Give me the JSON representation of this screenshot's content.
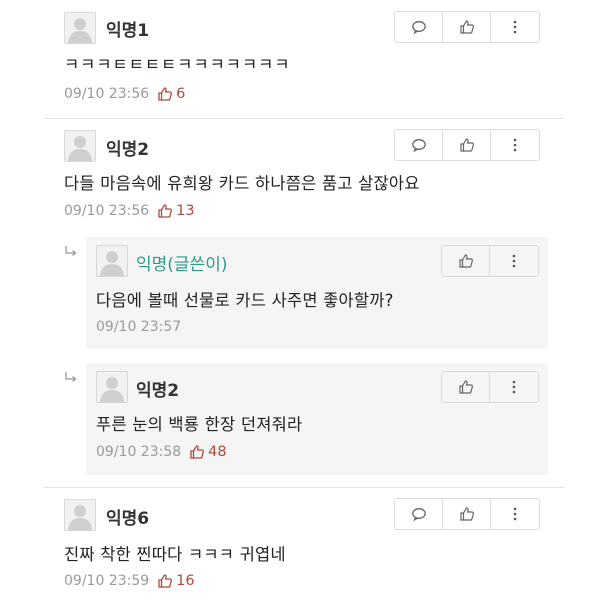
{
  "comments": [
    {
      "nickname": "익명1",
      "text": "ㅋㅋㅋㅌㅌㅌㅌㅋㅋㅋㅋㅋㅋㅋ",
      "time": "09/10 23:56",
      "likes": "6"
    },
    {
      "nickname": "익명2",
      "text": "다들 마음속에 유희왕 카드 하나쯤은 품고 살잖아요",
      "time": "09/10 23:56",
      "likes": "13"
    },
    {
      "nickname": "익명6",
      "text": "진짜 착한 찐따다 ㅋㅋㅋ 귀엽네",
      "time": "09/10 23:59",
      "likes": "16"
    }
  ],
  "replies": [
    {
      "nickname": "익명(글쓴이)",
      "text": "다음에 볼때 선물로 카드 사주면 좋아할까?",
      "time": "09/10 23:57",
      "likes": ""
    },
    {
      "nickname": "익명2",
      "text": "푸른 눈의 백룡 한장 던져줘라",
      "time": "09/10 23:58",
      "likes": "48"
    }
  ],
  "icons": {
    "reply": "speech-bubble-icon",
    "like": "thumbs-up-icon",
    "more": "vertical-dots-icon",
    "avatar": "default-avatar-icon"
  },
  "colors": {
    "author": "#2d9b8a",
    "like_count": "#b04a3a",
    "meta": "#9a9a9a",
    "reply_bg": "#f5f5f5"
  }
}
